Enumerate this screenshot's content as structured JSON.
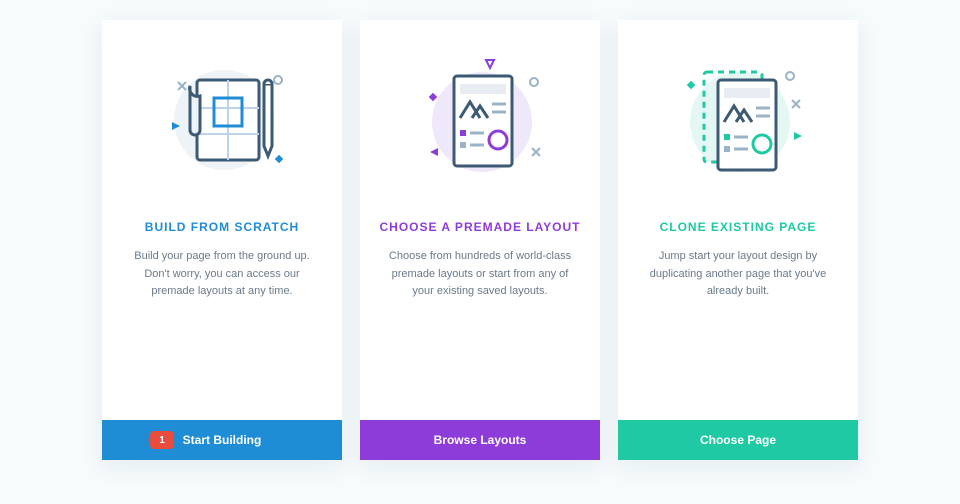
{
  "cards": [
    {
      "title": "BUILD FROM SCRATCH",
      "desc": "Build your page from the ground up. Don't worry, you can access our premade layouts at any time.",
      "button": "Start Building",
      "accent": "blue",
      "step_marker": "1"
    },
    {
      "title": "CHOOSE A PREMADE LAYOUT",
      "desc": "Choose from hundreds of world-class premade layouts or start from any of your existing saved layouts.",
      "button": "Browse Layouts",
      "accent": "purple"
    },
    {
      "title": "CLONE EXISTING PAGE",
      "desc": "Jump start your layout design by duplicating another page that you've already built.",
      "button": "Choose Page",
      "accent": "teal"
    }
  ],
  "colors": {
    "blue": "#1f8dd6",
    "purple": "#8e3cd9",
    "teal": "#1ec9a3"
  }
}
